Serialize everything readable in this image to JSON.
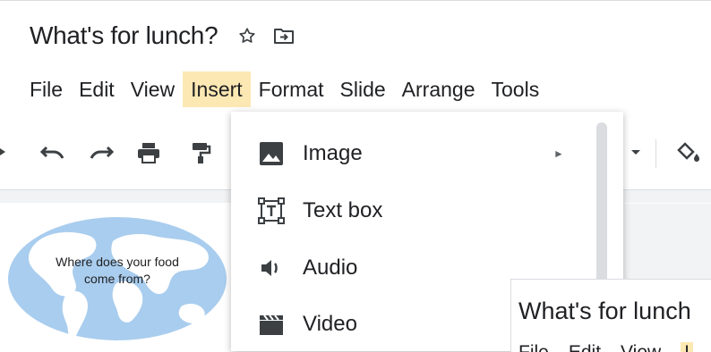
{
  "document": {
    "title": "What's for lunch?"
  },
  "title_icons": [
    "star-icon",
    "move-to-folder-icon"
  ],
  "menubar": {
    "items": [
      {
        "label": "File"
      },
      {
        "label": "Edit"
      },
      {
        "label": "View"
      },
      {
        "label": "Insert",
        "active": true
      },
      {
        "label": "Format"
      },
      {
        "label": "Slide"
      },
      {
        "label": "Arrange"
      },
      {
        "label": "Tools"
      }
    ]
  },
  "toolbar": {
    "icons": [
      "undo-icon",
      "redo-icon",
      "print-icon",
      "paint-format-icon",
      "dropdown-arrow-icon",
      "fill-color-icon"
    ]
  },
  "slide_thumbnail": {
    "text_line1": "Where does your food",
    "text_line2": "come from?"
  },
  "insert_menu": {
    "items": [
      {
        "label": "Image",
        "icon": "image-icon",
        "has_submenu": true,
        "submenu_glyph": "►"
      },
      {
        "label": "Text box",
        "icon": "text-box-icon",
        "has_submenu": false
      },
      {
        "label": "Audio",
        "icon": "audio-icon",
        "has_submenu": false
      },
      {
        "label": "Video",
        "icon": "video-icon",
        "has_submenu": false
      }
    ]
  },
  "inset_preview": {
    "title": "What's for lunch",
    "menu": [
      "File",
      "Edit",
      "View",
      "I"
    ]
  },
  "colors": {
    "active_menu_highlight": "#fce8b2",
    "text": "#202124",
    "icon": "#3c4043",
    "map_ocean": "#a9cdee",
    "map_land": "#ffffff"
  }
}
